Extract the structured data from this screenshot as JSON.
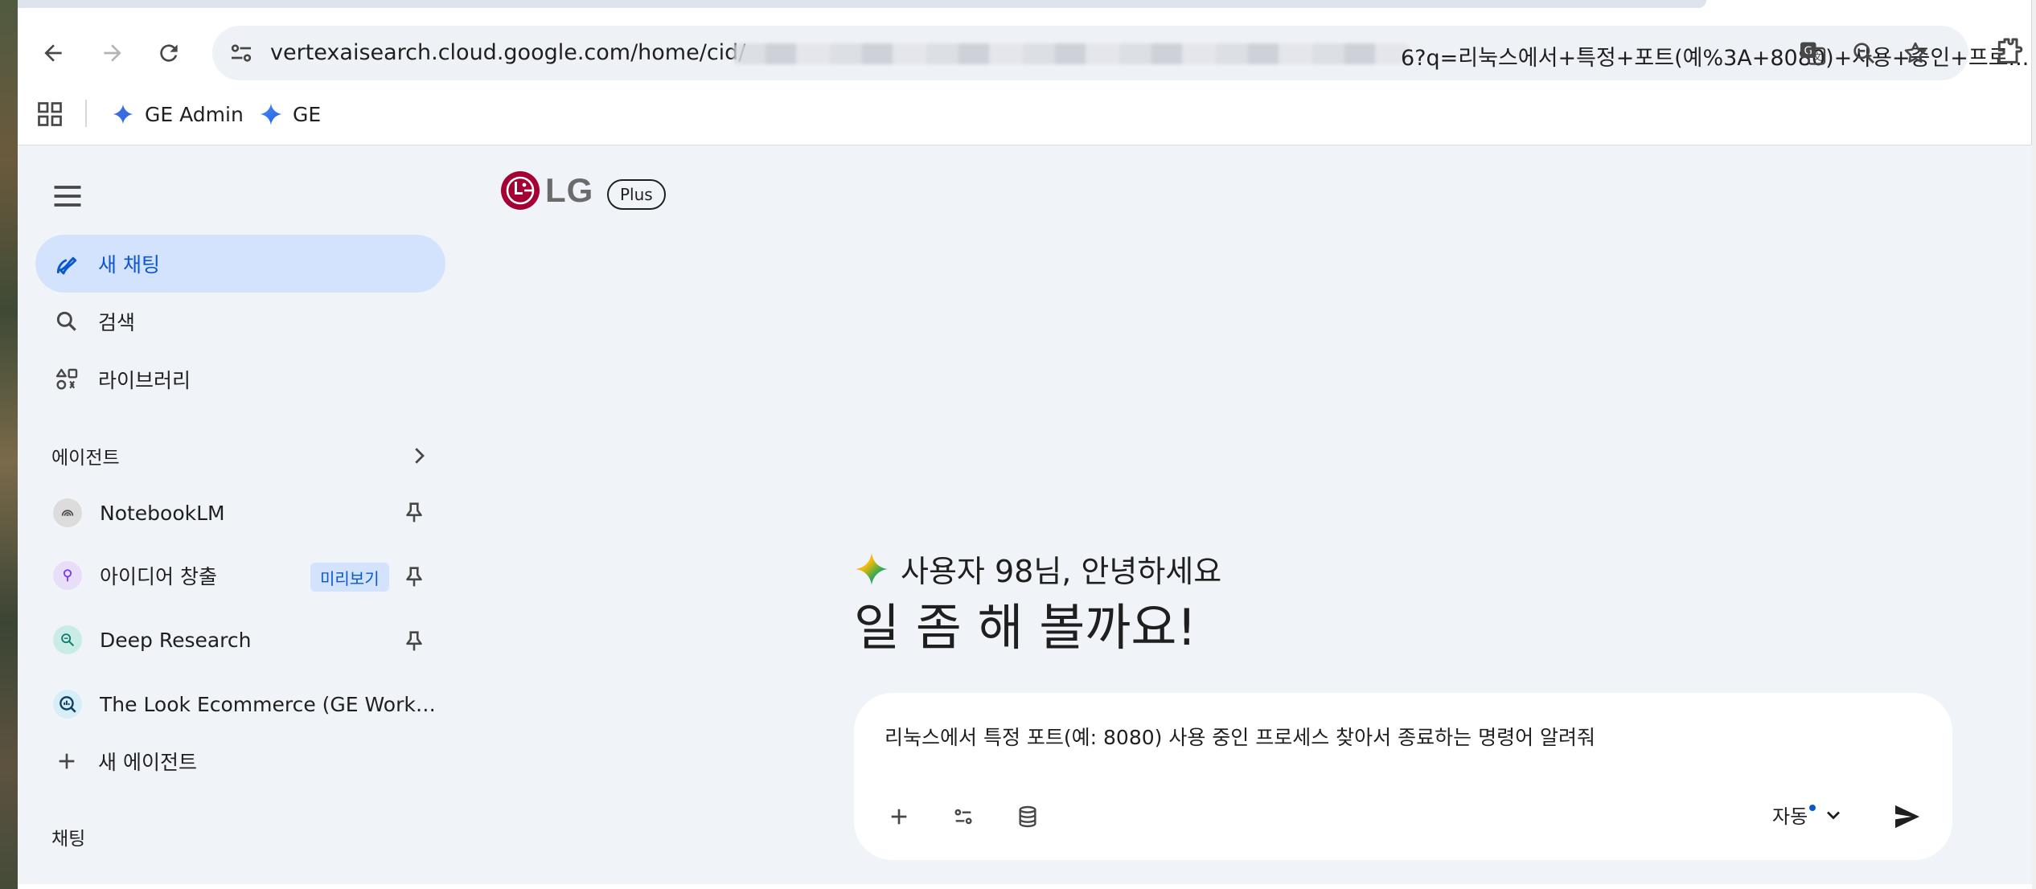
{
  "browser": {
    "url_host": "vertexaisearch.cloud.google.com/home/cid/",
    "url_tail": "6?q=리눅스에서+특정+포트(예%3A+8080)+사용+중인+프로...",
    "bookmarks": [
      {
        "label": "GE Admin",
        "icon": "sparkle-outline-icon"
      },
      {
        "label": "GE",
        "icon": "sparkle-filled-icon"
      }
    ]
  },
  "sidebar": {
    "nav": [
      {
        "label": "새 채팅",
        "icon": "edit-pen-icon",
        "active": true
      },
      {
        "label": "검색",
        "icon": "search-icon"
      },
      {
        "label": "라이브러리",
        "icon": "library-shapes-icon"
      }
    ],
    "agents_label": "에이전트",
    "agents": [
      {
        "label": "NotebookLM",
        "icon": "notebooklm-icon",
        "pinned": true
      },
      {
        "label": "아이디어 창출",
        "icon": "lightbulb-icon",
        "badge": "미리보기",
        "pinned": true
      },
      {
        "label": "Deep Research",
        "icon": "deep-research-icon",
        "pinned": true
      },
      {
        "label": "The Look Ecommerce (GE Workshop)",
        "icon": "data-insight-icon"
      }
    ],
    "new_agent_label": "새 에이전트",
    "chats_label": "채팅"
  },
  "main": {
    "brand": "LG",
    "plan_badge": "Plus",
    "greeting": "사용자 98님, 안녕하세요",
    "headline": "일 좀 해 볼까요!",
    "composer_text": "리눅스에서 특정 포트(예: 8080) 사용 중인 프로세스 찾아서 종료하는 명령어 알려줘",
    "mode_label": "자동"
  },
  "colors": {
    "accent": "#0b57d0",
    "active_bg": "#d3e3fd",
    "surface": "#f0f4f9",
    "lg_red": "#a50034"
  }
}
